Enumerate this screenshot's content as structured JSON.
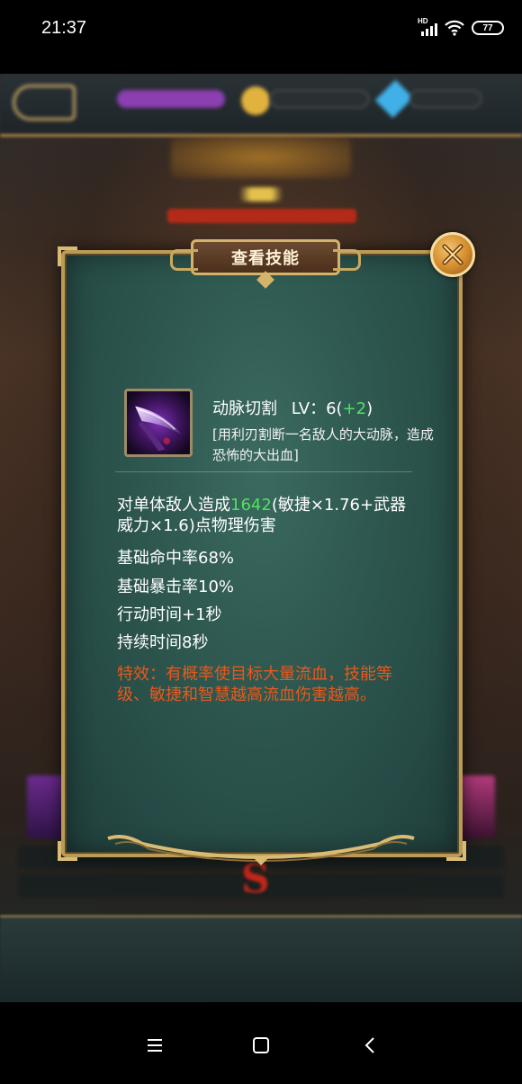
{
  "status_bar": {
    "time": "21:37",
    "network_label": "HD",
    "battery": "77",
    "icons": [
      "signal-icon",
      "wifi-icon",
      "battery-icon"
    ]
  },
  "dialog": {
    "title": "查看技能",
    "close_icon": "close-icon",
    "skill": {
      "icon": "blade-skill-icon",
      "name": "动脉切割",
      "level_label": "LV：6(",
      "level_bonus": "+2",
      "level_close": ")",
      "description": "[用利刃割断一名敌人的大动脉，造成恐怖的大出血]"
    },
    "effect": {
      "prefix": "对单体敌人造成",
      "damage": "1642",
      "suffix": "(敏捷×1.76+武器威力×1.6)点物理伤害"
    },
    "stats": [
      "基础命中率68%",
      "基础暴击率10%",
      "行动时间+1秒",
      "持续时间8秒"
    ],
    "special": "特效：有概率使目标大量流血，技能等级、敏捷和智慧越高流血伤害越高。"
  },
  "nav_bar": {
    "icons": [
      "menu-icon",
      "home-icon",
      "back-icon"
    ]
  },
  "colors": {
    "dialog_bg": "#2e5850",
    "frame_gold": "#b99a57",
    "highlight_green": "#4fe35f",
    "special_orange": "#e8591c"
  }
}
